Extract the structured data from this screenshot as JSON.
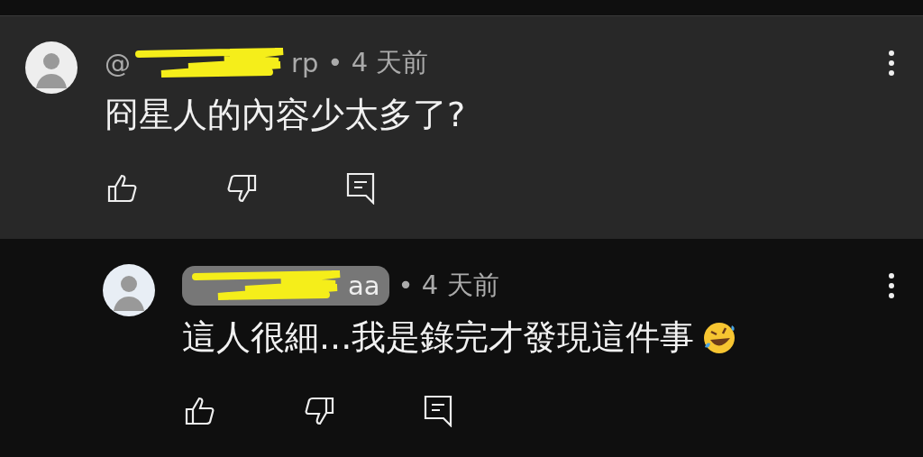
{
  "comments": [
    {
      "highlighted": true,
      "name_badge": false,
      "username_start": "@",
      "username_end": "rp",
      "time": "• 4 天前",
      "text": "冏星人的內容少太多了?",
      "reply": false
    },
    {
      "highlighted": false,
      "name_badge": true,
      "username_end": "aa",
      "time": "• 4 天前",
      "text": "這人很細...我是錄完才發現這件事",
      "reply": true
    }
  ]
}
